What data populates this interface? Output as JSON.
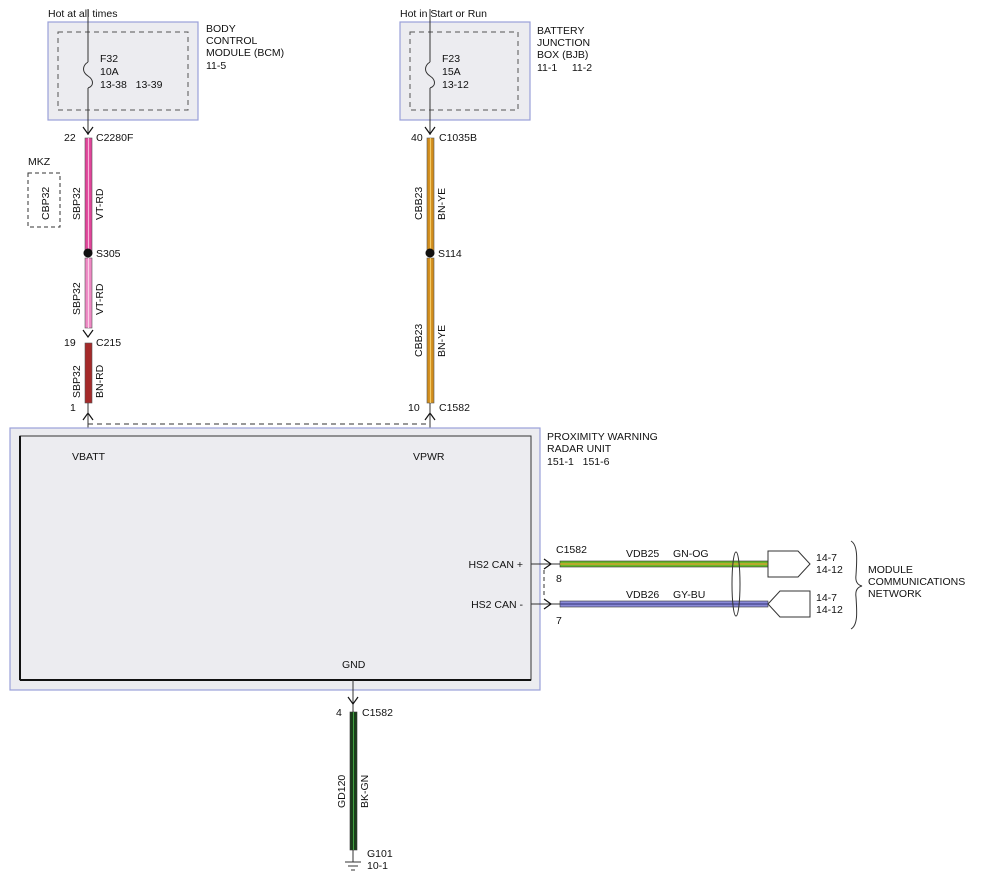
{
  "colors": {
    "box_fill": "#ececf0",
    "box_border": "#9aa0d8",
    "wire_vt": "#e0449a",
    "wire_vt_light": "#ee88c4",
    "wire_bn_rd": "#a52a2a",
    "wire_bn_ye": "#d08c1c",
    "wire_gn": "#6ab82a",
    "wire_gy_bu": "#8888d8",
    "wire_bk_gn": "#1a3d1a"
  },
  "bcm": {
    "header": "Hot at all times",
    "title_line1": "BODY",
    "title_line2": "CONTROL",
    "title_line3": "MODULE (BCM)",
    "page_ref": "11-5",
    "fuse_id": "F32",
    "fuse_rating": "10A",
    "fuse_refs": "13-38   13-39",
    "fuse_icon": "fuse-icon"
  },
  "bjb": {
    "header": "Hot in Start or Run",
    "title_line1": "BATTERY",
    "title_line2": "JUNCTION",
    "title_line3": "BOX (BJB)",
    "page_ref": "11-1     11-2",
    "fuse_id": "F23",
    "fuse_rating": "15A",
    "fuse_refs": "13-12",
    "fuse_icon": "fuse-icon"
  },
  "left_circuit": {
    "pin_top": "22",
    "connector_top": "C2280F",
    "option_label": "MKZ",
    "option_circuit": "CBP32",
    "seg1_circuit": "SBP32",
    "seg1_color": "VT-RD",
    "splice": "S305",
    "seg2_circuit": "SBP32",
    "seg2_color": "VT-RD",
    "pin_mid": "19",
    "connector_mid": "C215",
    "seg3_circuit": "SBP32",
    "seg3_color": "BN-RD",
    "pin_bottom": "1"
  },
  "right_circuit": {
    "pin_top": "40",
    "connector_top": "C1035B",
    "seg1_circuit": "CBB23",
    "seg1_color": "BN-YE",
    "splice": "S114",
    "seg2_circuit": "CBB23",
    "seg2_color": "BN-YE",
    "pin_bottom": "10",
    "connector_bottom": "C1582"
  },
  "radar": {
    "title_line1": "PROXIMITY WARNING",
    "title_line2": "RADAR UNIT",
    "page_ref": "151-1   151-6",
    "pin_vbatt": "VBATT",
    "pin_vpwr": "VPWR",
    "pin_can_plus": "HS2 CAN +",
    "pin_can_minus": "HS2 CAN -",
    "pin_gnd": "GND"
  },
  "can_bus": {
    "connector": "C1582",
    "pin_plus": "8",
    "pin_minus": "7",
    "plus_circuit": "VDB25",
    "plus_color": "GN-OG",
    "minus_circuit": "VDB26",
    "minus_color": "GY-BU",
    "plus_ref1": "14-7",
    "plus_ref2": "14-12",
    "minus_ref1": "14-7",
    "minus_ref2": "14-12",
    "network_line1": "MODULE",
    "network_line2": "COMMUNICATIONS",
    "network_line3": "NETWORK"
  },
  "ground": {
    "pin": "4",
    "connector": "C1582",
    "circuit": "GD120",
    "color": "BK-GN",
    "ground_id": "G101",
    "ground_ref": "10-1",
    "ground_icon": "ground-symbol-icon"
  }
}
